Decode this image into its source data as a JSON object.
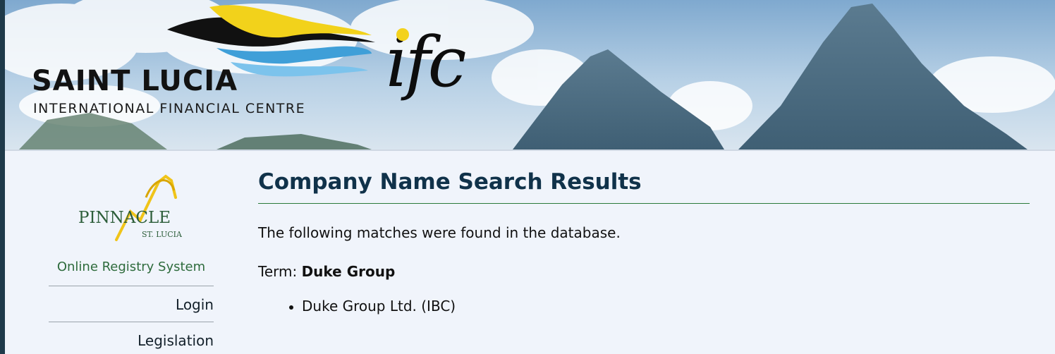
{
  "banner": {
    "title": "SAINT LUCIA",
    "subtitle": "INTERNATIONAL FINANCIAL CENTRE",
    "ifc_mark": "ifc"
  },
  "sidebar": {
    "logo_word": "PINNACLE",
    "logo_sub": "ST. LUCIA",
    "system_title": "Online Registry System",
    "links": [
      {
        "label": "Login"
      },
      {
        "label": "Legislation"
      }
    ]
  },
  "main": {
    "title": "Company Name Search Results",
    "intro": "The following matches were found in the database.",
    "term_label": "Term:",
    "term_value": "Duke Group",
    "results": [
      "Duke Group Ltd. (IBC)"
    ]
  },
  "colors": {
    "page_bg": "#f0f4fb",
    "title": "#10324a",
    "accent_green": "#2e6b3c",
    "rule_green": "#2a7a3a",
    "sky": "#8fb6d8",
    "mountain": "#4f6f86"
  },
  "icons": [
    "banner-logo-waves",
    "pinnacle-mountain-logo",
    "ifc-dot-icon"
  ]
}
